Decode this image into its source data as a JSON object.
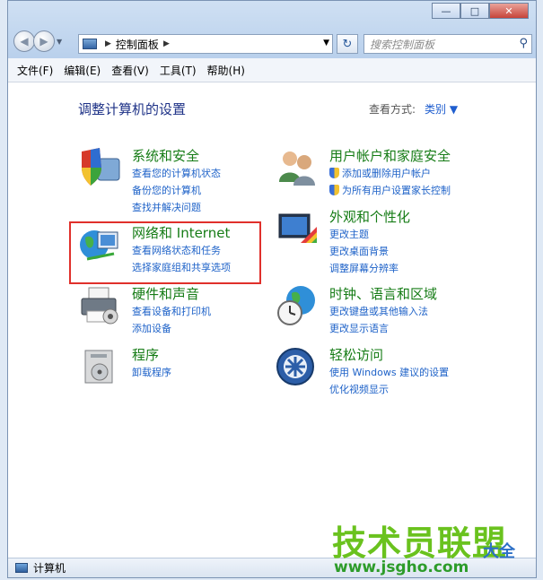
{
  "window": {
    "caption_buttons": {
      "minimize": "—",
      "maximize": "□",
      "close": "✕"
    }
  },
  "navigation": {
    "back_icon": "back-arrow-icon",
    "forward_icon": "forward-arrow-icon",
    "history_icon": "chevron-down-icon"
  },
  "address_bar": {
    "path": "控制面板",
    "sep_glyph": "▶",
    "drop_glyph": "▼"
  },
  "refresh_glyph": "↻",
  "search": {
    "placeholder": "搜索控制面板",
    "icon": "search-icon"
  },
  "menu": {
    "file": "文件(F)",
    "edit": "编辑(E)",
    "view": "查看(V)",
    "tools": "工具(T)",
    "help": "帮助(H)"
  },
  "main": {
    "title": "调整计算机的设置",
    "view_by_label": "查看方式:",
    "view_by_value": "类别 ▼"
  },
  "categories": {
    "system": {
      "title": "系统和安全",
      "icon": "shield-pc-icon",
      "links": [
        "查看您的计算机状态",
        "备份您的计算机",
        "查找并解决问题"
      ]
    },
    "network": {
      "title": "网络和 Internet",
      "icon": "network-globe-icon",
      "links": [
        "查看网络状态和任务",
        "选择家庭组和共享选项"
      ]
    },
    "hardware": {
      "title": "硬件和声音",
      "icon": "printer-icon",
      "links": [
        "查看设备和打印机",
        "添加设备"
      ]
    },
    "programs": {
      "title": "程序",
      "icon": "programs-box-icon",
      "links": [
        "卸载程序"
      ]
    },
    "accounts": {
      "title": "用户帐户和家庭安全",
      "icon": "users-icon",
      "links": [
        "添加或删除用户帐户",
        "为所有用户设置家长控制"
      ]
    },
    "appearance": {
      "title": "外观和个性化",
      "icon": "display-paint-icon",
      "links": [
        "更改主题",
        "更改桌面背景",
        "调整屏幕分辨率"
      ]
    },
    "clock": {
      "title": "时钟、语言和区域",
      "icon": "clock-globe-icon",
      "links": [
        "更改键盘或其他输入法",
        "更改显示语言"
      ]
    },
    "ease": {
      "title": "轻松访问",
      "icon": "ease-of-access-icon",
      "links": [
        "使用 Windows 建议的设置",
        "优化视频显示"
      ]
    }
  },
  "status_bar": {
    "text": "计算机"
  },
  "watermark": {
    "main": "技术员联盟",
    "url": "www.jsgho.com",
    "side": "大全"
  },
  "colors": {
    "category_title": "#167c16",
    "link": "#1e62c8",
    "title": "#1e3287",
    "highlight": "#e0302b"
  }
}
